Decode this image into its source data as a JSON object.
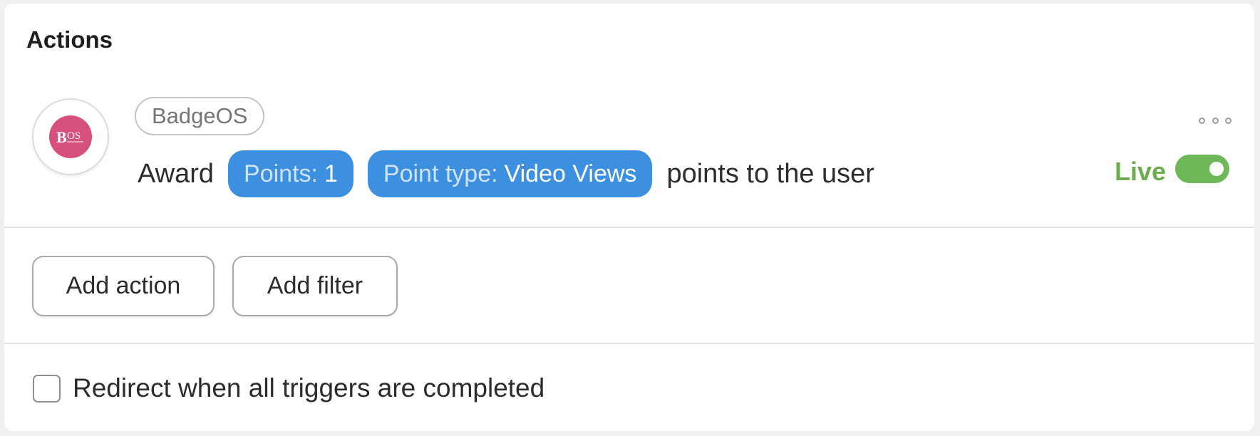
{
  "panel": {
    "title": "Actions"
  },
  "action": {
    "integration_icon": "badgeos-logo-icon",
    "integration_name": "BadgeOS",
    "sentence": {
      "prefix": "Award",
      "points_pill": {
        "key": "Points:",
        "value": "1"
      },
      "point_type_pill": {
        "key": "Point type:",
        "value": "Video Views"
      },
      "suffix": "points to the user"
    },
    "more_menu_icon": "more-horizontal-icon",
    "status": {
      "label": "Live",
      "enabled": true,
      "color": "#6fab52"
    }
  },
  "buttons": {
    "add_action": "Add action",
    "add_filter": "Add filter"
  },
  "redirect_option": {
    "label": "Redirect when all triggers are completed",
    "checked": false
  },
  "colors": {
    "pill_background": "#3d8fe0",
    "toggle_on": "#6fb859",
    "badgeos_brand": "#d6507e"
  }
}
